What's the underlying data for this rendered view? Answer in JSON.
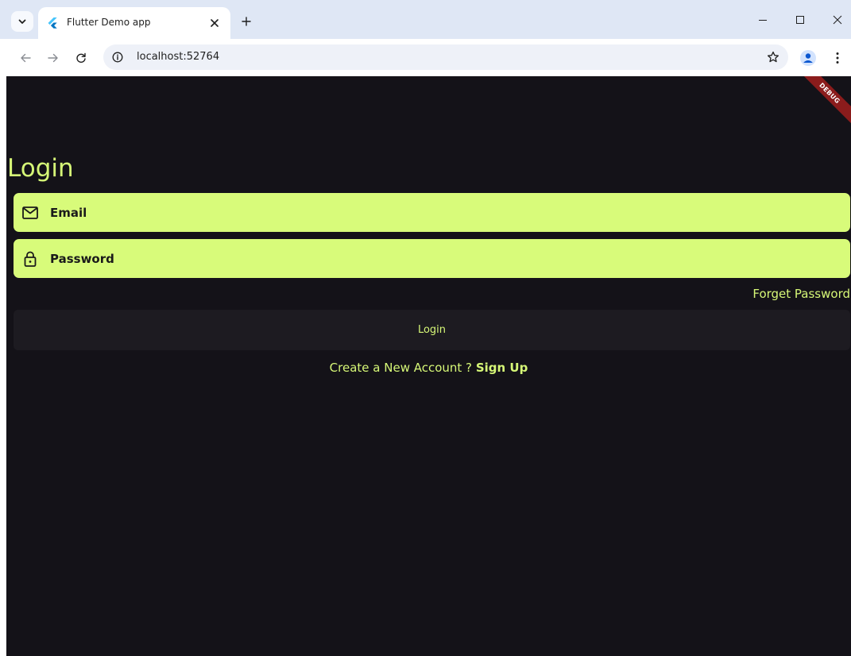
{
  "browser": {
    "tab_title": "Flutter Demo app",
    "url": "localhost:52764"
  },
  "app": {
    "debug_banner": "DEBUG",
    "title": "Login",
    "email_placeholder": "Email",
    "password_placeholder": "Password",
    "forgot_password": "Forget Password",
    "login_button": "Login",
    "signup_prompt": "Create a New Account ?",
    "signup_link": "Sign Up"
  },
  "colors": {
    "accent": "#d6f777",
    "field_bg": "#d8fb7a",
    "background": "#141218"
  },
  "icons": {
    "email": "mail-icon",
    "password": "lock-icon"
  }
}
